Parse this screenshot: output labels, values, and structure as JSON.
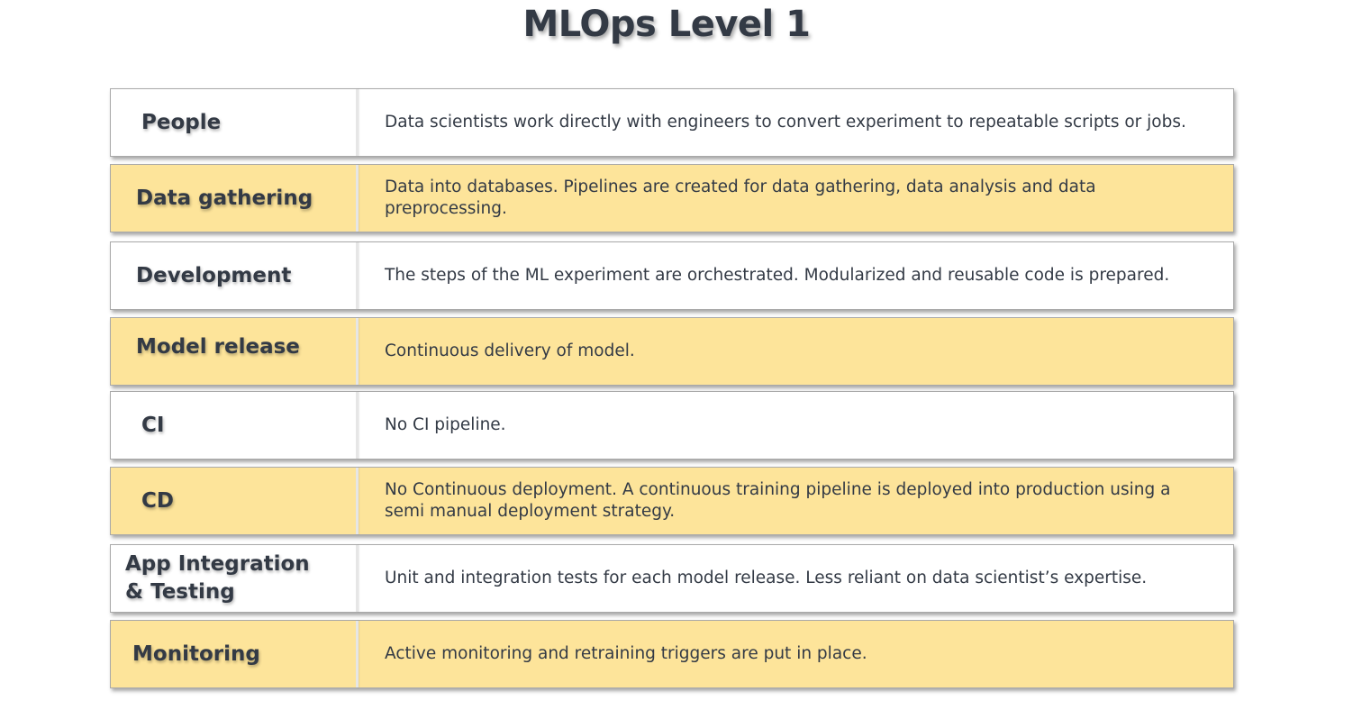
{
  "title": "MLOps Level 1",
  "rows": [
    {
      "label": "People",
      "description": "Data scientists work directly with engineers to convert experiment to repeatable scripts or jobs.",
      "highlight": false
    },
    {
      "label": "Data gathering",
      "description": "Data into databases. Pipelines are created for data gathering, data analysis and data preprocessing.",
      "highlight": true
    },
    {
      "label": "Development",
      "description": "The steps of the ML experiment are orchestrated.  Modularized  and reusable code is prepared.",
      "highlight": false
    },
    {
      "label": "Model release",
      "description": "Continuous delivery of model.",
      "highlight": true
    },
    {
      "label": "CI",
      "description": "No CI pipeline.",
      "highlight": false
    },
    {
      "label": "CD",
      "description": "No Continuous deployment. A continuous training  pipeline is deployed into production using a semi manual deployment strategy.",
      "highlight": true
    },
    {
      "label": "App Integration\n& Testing",
      "description": "Unit and integration tests for each model release. Less reliant on data scientist’s expertise.",
      "highlight": false
    },
    {
      "label": "Monitoring",
      "description": "Active monitoring and retraining triggers are put in place.",
      "highlight": true
    }
  ],
  "colors": {
    "highlight_fill": "#fde49a",
    "plain_fill": "#ffffff",
    "text": "#333a45",
    "border": "#a9a9a9"
  }
}
